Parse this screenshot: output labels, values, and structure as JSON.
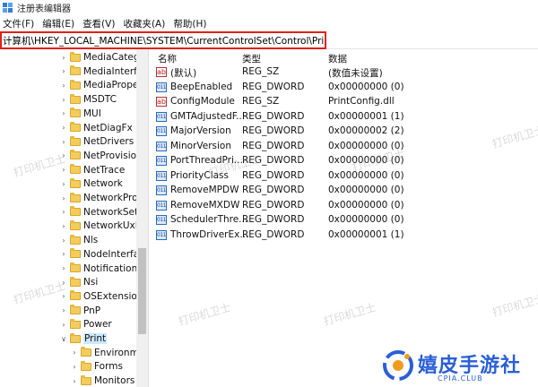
{
  "window": {
    "title": "注册表编辑器"
  },
  "menu": [
    "文件(F)",
    "编辑(E)",
    "查看(V)",
    "收藏夹(A)",
    "帮助(H)"
  ],
  "address": {
    "path": "计算机\\HKEY_LOCAL_MACHINE\\SYSTEM\\CurrentControlSet\\Control\\Print"
  },
  "tree": {
    "items": [
      {
        "label": "MediaCategc",
        "selected": false
      },
      {
        "label": "MediaInterfa",
        "selected": false
      },
      {
        "label": "MediaProper",
        "selected": false
      },
      {
        "label": "MSDTC",
        "selected": false
      },
      {
        "label": "MUI",
        "selected": false
      },
      {
        "label": "NetDiagFx",
        "selected": false
      },
      {
        "label": "NetDrivers",
        "selected": false
      },
      {
        "label": "NetProvision",
        "selected": false
      },
      {
        "label": "NetTrace",
        "selected": false
      },
      {
        "label": "Network",
        "selected": false
      },
      {
        "label": "NetworkProv",
        "selected": false
      },
      {
        "label": "NetworkSetu",
        "selected": false
      },
      {
        "label": "NetworkUxM",
        "selected": false
      },
      {
        "label": "Nls",
        "selected": false
      },
      {
        "label": "NodeInterfac",
        "selected": false
      },
      {
        "label": "Notifications",
        "selected": false
      },
      {
        "label": "Nsi",
        "selected": false
      },
      {
        "label": "OSExtensionl",
        "selected": false
      },
      {
        "label": "PnP",
        "selected": false
      },
      {
        "label": "Power",
        "selected": false
      },
      {
        "label": "Print",
        "selected": true,
        "expanded": true
      },
      {
        "label": "Environme",
        "child": true
      },
      {
        "label": "Forms",
        "child": true
      },
      {
        "label": "Monitors",
        "child": true
      }
    ]
  },
  "list": {
    "headers": {
      "name": "名称",
      "type": "类型",
      "data": "数据"
    },
    "rows": [
      {
        "icon": "string-value-icon",
        "name": "(默认)",
        "type": "REG_SZ",
        "data": "(数值未设置)"
      },
      {
        "icon": "dword-value-icon",
        "name": "BeepEnabled",
        "type": "REG_DWORD",
        "data": "0x00000000 (0)"
      },
      {
        "icon": "string-value-icon",
        "name": "ConfigModule",
        "type": "REG_SZ",
        "data": "PrintConfig.dll"
      },
      {
        "icon": "dword-value-icon",
        "name": "GMTAdjustedF...",
        "type": "REG_DWORD",
        "data": "0x00000001 (1)"
      },
      {
        "icon": "dword-value-icon",
        "name": "MajorVersion",
        "type": "REG_DWORD",
        "data": "0x00000002 (2)"
      },
      {
        "icon": "dword-value-icon",
        "name": "MinorVersion",
        "type": "REG_DWORD",
        "data": "0x00000000 (0)"
      },
      {
        "icon": "dword-value-icon",
        "name": "PortThreadPri...",
        "type": "REG_DWORD",
        "data": "0x00000000 (0)"
      },
      {
        "icon": "dword-value-icon",
        "name": "PriorityClass",
        "type": "REG_DWORD",
        "data": "0x00000000 (0)"
      },
      {
        "icon": "dword-value-icon",
        "name": "RemoveMPDW",
        "type": "REG_DWORD",
        "data": "0x00000000 (0)"
      },
      {
        "icon": "dword-value-icon",
        "name": "RemoveMXDW",
        "type": "REG_DWORD",
        "data": "0x00000000 (0)"
      },
      {
        "icon": "dword-value-icon",
        "name": "SchedulerThre...",
        "type": "REG_DWORD",
        "data": "0x00000000 (0)"
      },
      {
        "icon": "dword-value-icon",
        "name": "ThrowDriverEx...",
        "type": "REG_DWORD",
        "data": "0x00000001 (1)"
      }
    ]
  },
  "watermark": {
    "text": "打印机卫士"
  },
  "brand": {
    "name": "嬉皮手游社",
    "sub": "CPIA.CLUB"
  },
  "colors": {
    "highlight": "#e0201b",
    "folder": "#f3cd5c",
    "selection": "#cce8ff",
    "brand": "#2a5fd6"
  }
}
